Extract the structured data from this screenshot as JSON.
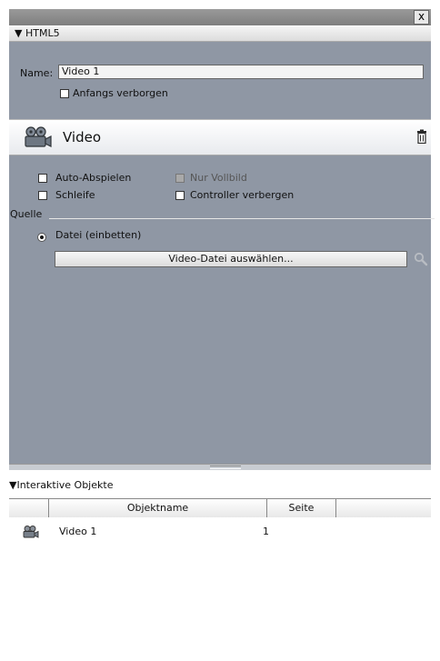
{
  "window": {
    "close_label": "x"
  },
  "html5_section": {
    "title": "HTML5"
  },
  "properties": {
    "name_label": "Name:",
    "name_value": "Video 1",
    "initially_hidden_label": "Anfangs verborgen"
  },
  "video_bar": {
    "title": "Video"
  },
  "options": {
    "autoplay_label": "Auto-Abspielen",
    "fullscreen_label": "Nur Vollbild",
    "loop_label": "Schleife",
    "hide_controller_label": "Controller verbergen"
  },
  "source": {
    "label": "Quelle",
    "embed_file_label": "Datei (einbetten)",
    "choose_button_label": "Video-Datei auswählen..."
  },
  "interactive_objects": {
    "title": "Interaktive Objekte",
    "columns": [
      "Objektname",
      "Seite"
    ],
    "rows": [
      {
        "name": "Video 1",
        "page": "1"
      }
    ]
  },
  "colors": {
    "panel_bg": "#8f97a4",
    "titlebar": "#8a8a8a"
  }
}
